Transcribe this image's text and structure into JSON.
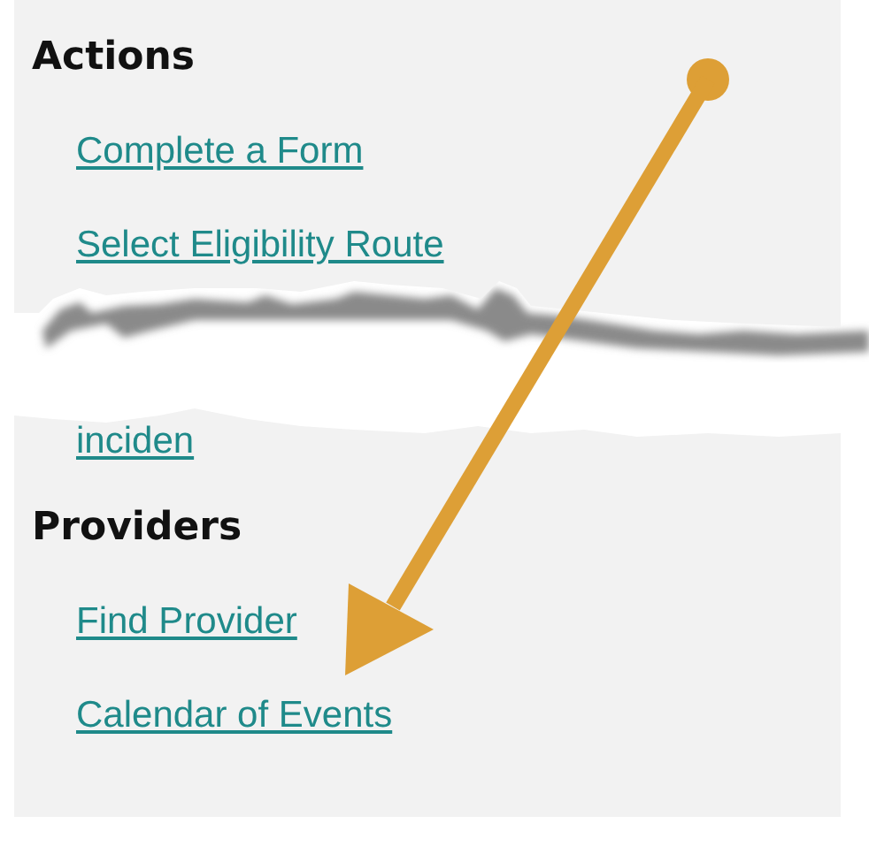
{
  "actions": {
    "heading": "Actions",
    "links": [
      "Complete a Form",
      "Select Eligibility Route"
    ]
  },
  "cut_off_link": "inciden",
  "providers": {
    "heading": "Providers",
    "links": [
      "Find Provider",
      "Calendar of Events"
    ]
  }
}
